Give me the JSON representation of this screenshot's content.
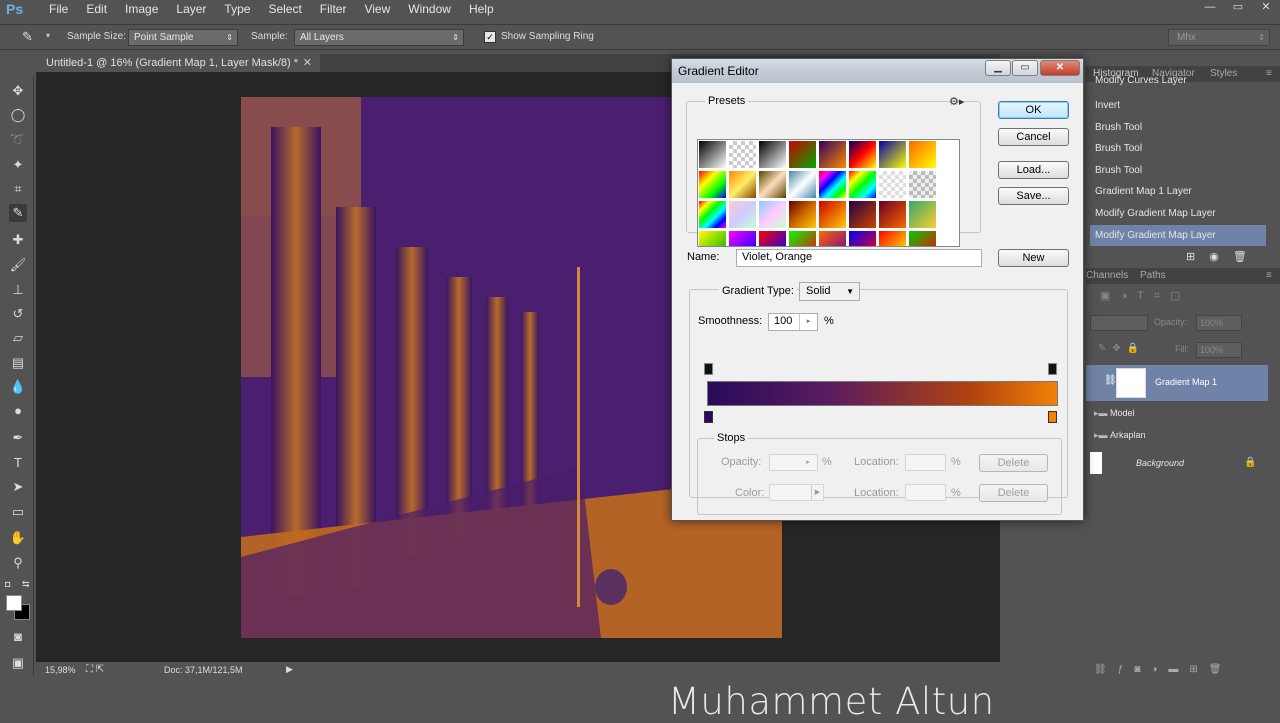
{
  "app": {
    "logo": "Ps"
  },
  "menu": [
    "File",
    "Edit",
    "Image",
    "Layer",
    "Type",
    "Select",
    "Filter",
    "View",
    "Window",
    "Help"
  ],
  "window_controls": [
    "—",
    "▭",
    "✕"
  ],
  "options": {
    "sample_size_label": "Sample Size:",
    "sample_size_value": "Point Sample",
    "sample_label": "Sample:",
    "sample_value": "All Layers",
    "show_ring_label": "Show Sampling Ring",
    "workspace": "Mhx"
  },
  "document": {
    "tab_title": "Untitled-1 @ 16% (Gradient Map 1, Layer Mask/8) *",
    "zoom": "15,98%",
    "doc_info": "Doc: 37,1M/121,5M"
  },
  "panels": {
    "top_tabs": [
      "Histogram",
      "Navigator",
      "Styles"
    ],
    "history": [
      "Modify Curves Layer",
      "Invert",
      "Brush Tool",
      "Brush Tool",
      "Brush Tool",
      "Gradient Map 1 Layer",
      "Modify Gradient Map Layer",
      "Modify Gradient Map Layer"
    ],
    "mid_tabs": [
      "Channels",
      "Paths"
    ],
    "opacity_label": "Opacity:",
    "opacity_value": "100%",
    "fill_label": "Fill:",
    "fill_value": "100%",
    "layers": [
      {
        "name": "Gradient Map 1"
      },
      {
        "name": "Model"
      },
      {
        "name": "Arkaplan"
      },
      {
        "name": "Background"
      }
    ]
  },
  "dialog": {
    "title": "Gradient Editor",
    "presets_label": "Presets",
    "ok": "OK",
    "cancel": "Cancel",
    "load": "Load...",
    "save": "Save...",
    "name_label": "Name:",
    "name_value": "Violet, Orange",
    "new": "New",
    "gradient_type_label": "Gradient Type:",
    "gradient_type_value": "Solid",
    "smoothness_label": "Smoothness:",
    "smoothness_value": "100",
    "percent": "%",
    "stops_label": "Stops",
    "opacity_label": "Opacity:",
    "color_label": "Color:",
    "location_label": "Location:",
    "delete": "Delete",
    "gradient_colors": {
      "start": "#290a5a",
      "end": "#f28105"
    }
  },
  "watermark": "Muhammet Altun"
}
